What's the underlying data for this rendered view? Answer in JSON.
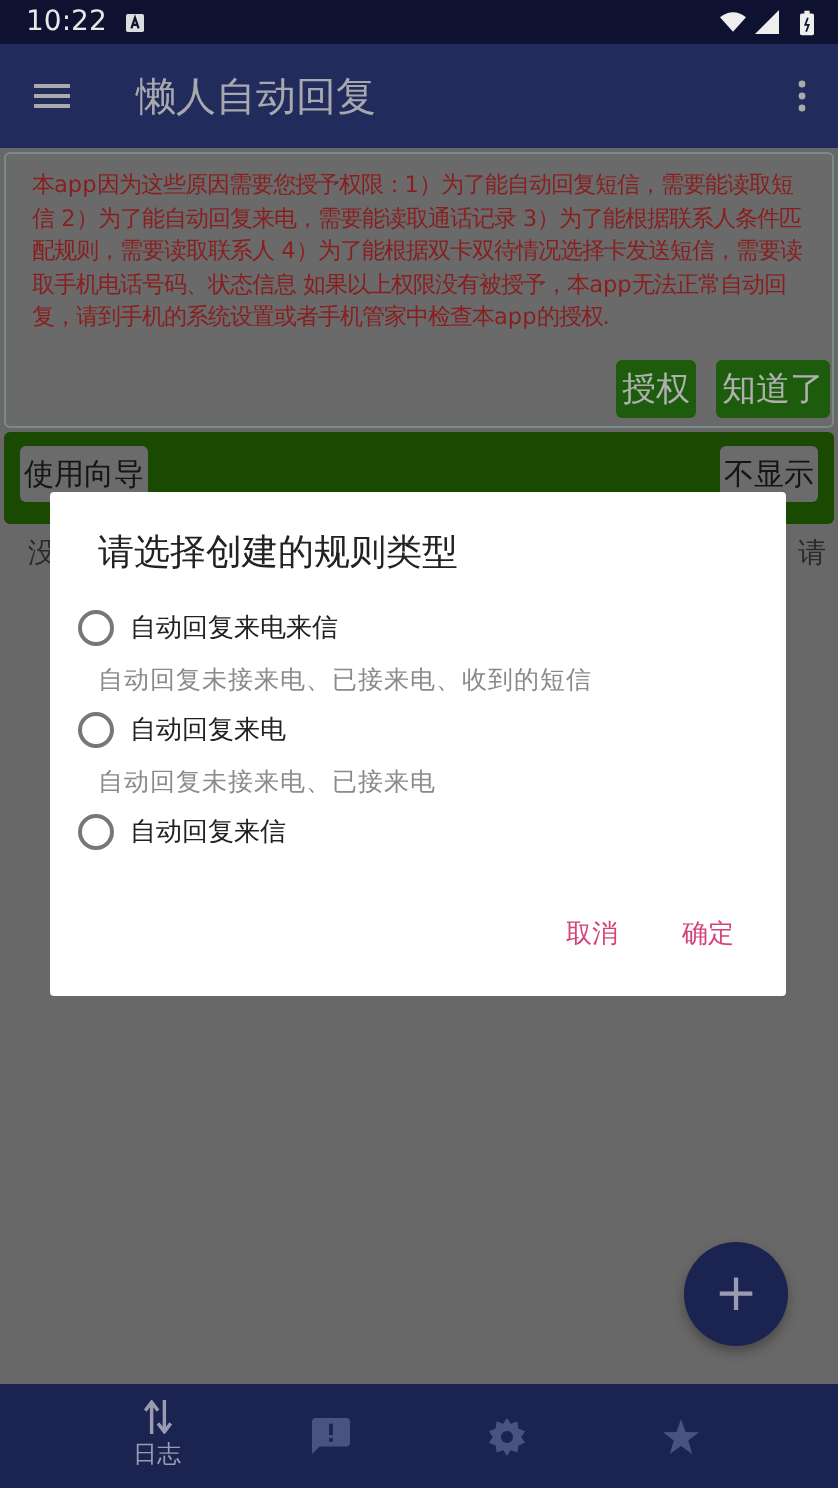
{
  "status_bar": {
    "time": "10:22"
  },
  "app_bar": {
    "title": "懒人自动回复"
  },
  "notice": {
    "text": "本app因为这些原因需要您授予权限：1）为了能自动回复短信，需要能读取短信 2）为了能自动回复来电，需要能读取通话记录 3）为了能根据联系人条件匹配规则，需要读取联系人 4）为了能根据双卡双待情况选择卡发送短信，需要读取手机电话号码、状态信息 如果以上权限没有被授予，本app无法正常自动回复，请到手机的系统设置或者手机管家中检查本app的授权.",
    "buttons": [
      "授权",
      "知道了"
    ]
  },
  "guide_bar": {
    "buttons": [
      "使用向导",
      "不显示"
    ]
  },
  "hint_line": {
    "start": "没",
    "end": "请"
  },
  "dialog": {
    "title": "请选择创建的规则类型",
    "options": [
      {
        "label": "自动回复来电来信",
        "description": "自动回复未接来电、已接来电、收到的短信",
        "selected": false
      },
      {
        "label": "自动回复来电",
        "description": "自动回复未接来电、已接来电",
        "selected": false
      },
      {
        "label": "自动回复来信",
        "selected": false
      }
    ],
    "buttons": [
      "取消",
      "确定"
    ]
  },
  "fab": {
    "label": "+"
  },
  "bottom_nav": [
    {
      "kind": "log",
      "label": "日志",
      "selected": true
    },
    {
      "kind": "feedback",
      "selected": false
    },
    {
      "kind": "settings",
      "selected": false
    },
    {
      "kind": "favorites",
      "selected": false
    }
  ]
}
